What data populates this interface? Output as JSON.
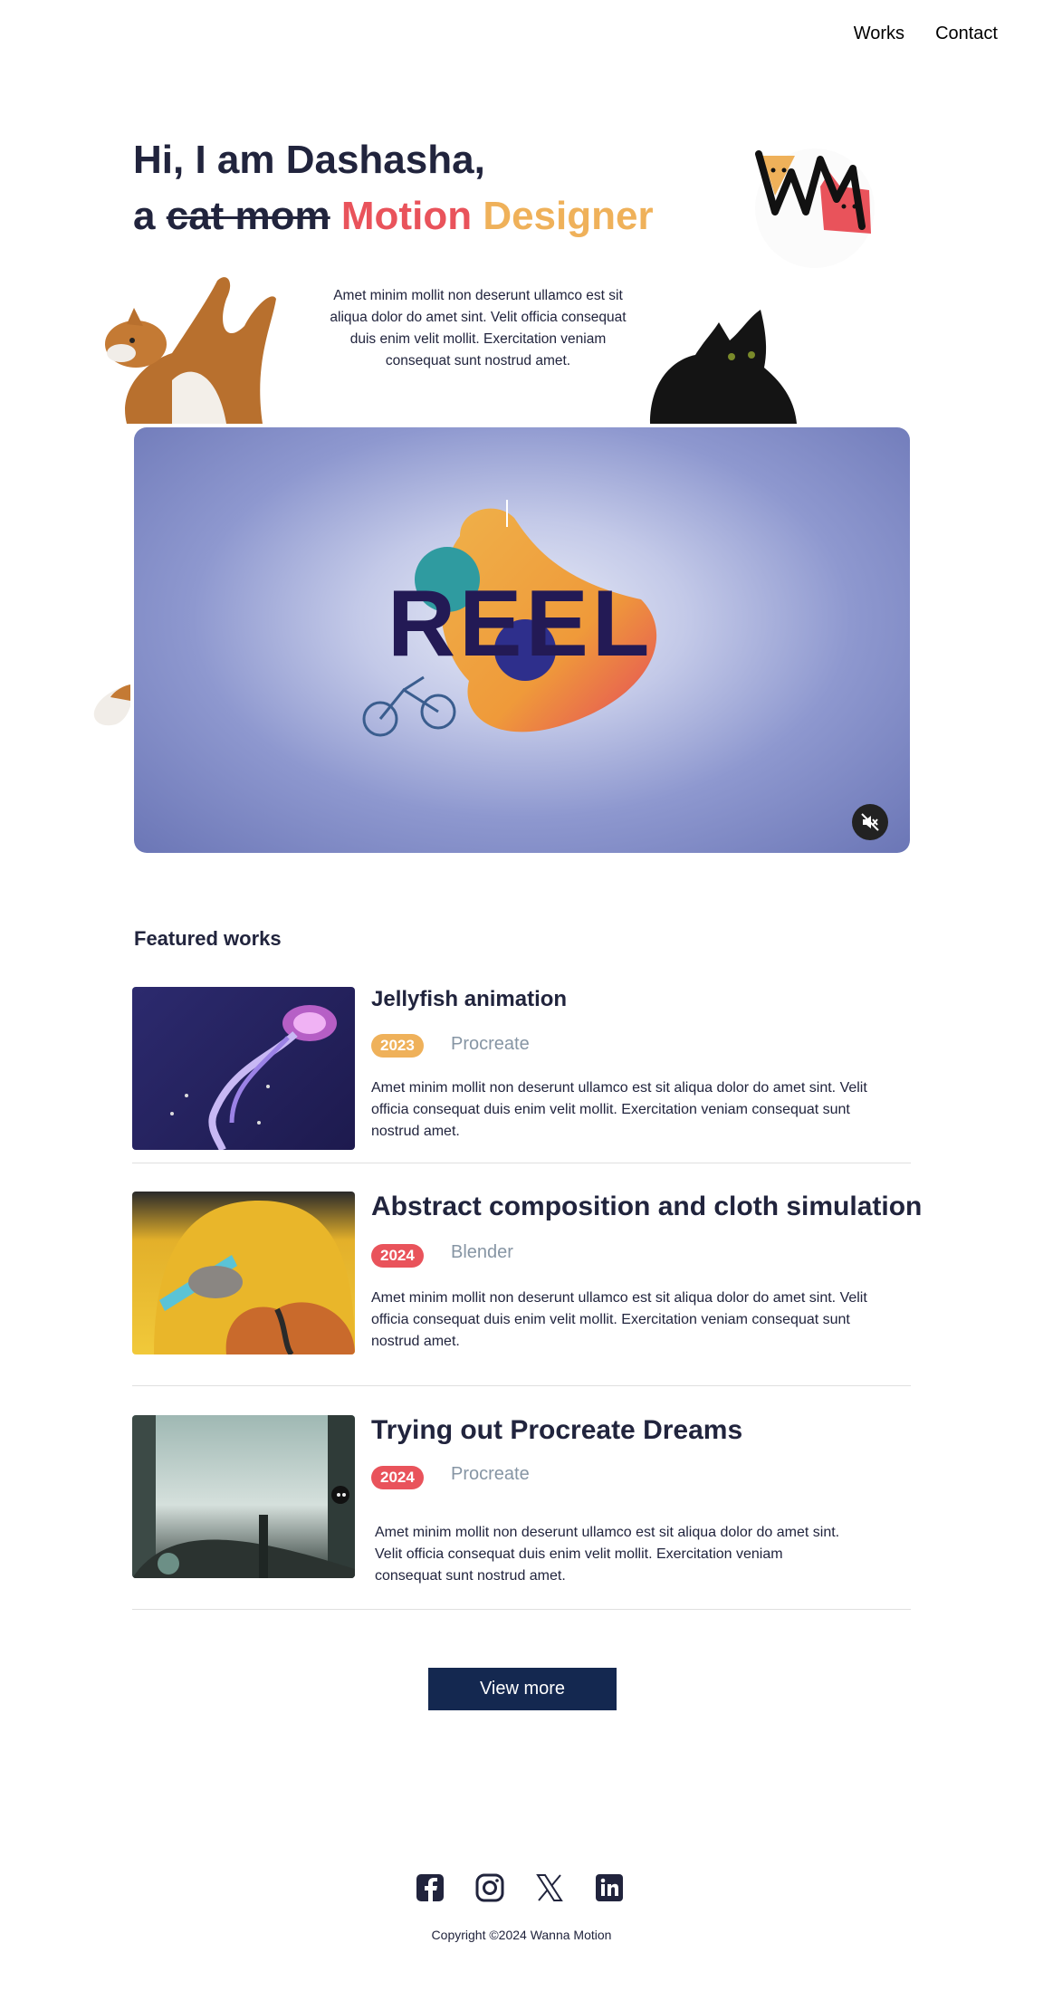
{
  "nav": {
    "works": "Works",
    "contact": "Contact"
  },
  "hero": {
    "greeting": "Hi, I am Dashasha,",
    "prefix": "a",
    "struck": "cat mom",
    "role_word1": "Motion",
    "role_word2": "Designer",
    "description": "Amet minim mollit non deserunt ullamco est sit aliqua dolor do amet sint. Velit officia consequat duis enim velit mollit. Exercitation veniam consequat sunt nostrud amet.",
    "logo_icon": "wm-cats-logo"
  },
  "video": {
    "title_text": "REEL",
    "mute_icon": "mute-icon"
  },
  "featured": {
    "title": "Featured works",
    "works": [
      {
        "title": "Jellyfish animation",
        "year": "2023",
        "year_color": "#efb15a",
        "tool": "Procreate",
        "description": "Amet minim mollit non deserunt ullamco est sit aliqua dolor do amet sint. Velit officia consequat duis enim velit mollit. Exercitation veniam consequat sunt nostrud amet."
      },
      {
        "title": "Abstract composition and cloth simulation",
        "year": "2024",
        "year_color": "#e9535b",
        "tool": "Blender",
        "description": "Amet minim mollit non deserunt ullamco est sit aliqua dolor do amet sint. Velit officia consequat duis enim velit mollit. Exercitation veniam consequat sunt nostrud amet."
      },
      {
        "title": "Trying out Procreate Dreams",
        "year": "2024",
        "year_color": "#e9535b",
        "tool": "Procreate",
        "description": "Amet minim mollit non deserunt ullamco est sit aliqua dolor do amet sint. Velit officia consequat duis enim velit mollit. Exercitation veniam consequat sunt nostrud amet."
      }
    ]
  },
  "view_more": "View more",
  "footer": {
    "socials": [
      "facebook-icon",
      "instagram-icon",
      "x-icon",
      "linkedin-icon"
    ],
    "copyright": "Copyright ©2024 Wanna Motion"
  },
  "colors": {
    "dark": "#21243d",
    "accent_red": "#e9535b",
    "accent_yellow": "#efb15a",
    "button": "#142850",
    "muted": "#8695a4"
  }
}
